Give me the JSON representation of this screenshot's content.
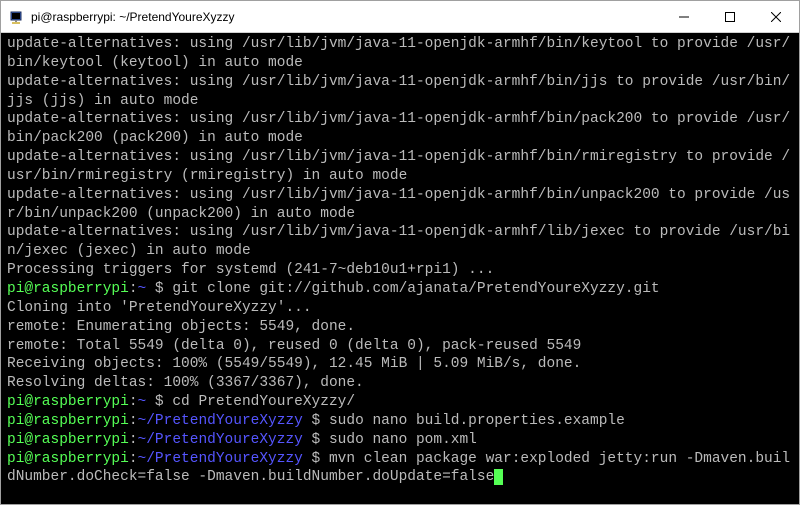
{
  "window": {
    "title": "pi@raspberrypi: ~/PretendYoureXyzzy"
  },
  "terminal": {
    "lines": [
      "update-alternatives: using /usr/lib/jvm/java-11-openjdk-armhf/bin/keytool to provide /usr/bin/keytool (keytool) in auto mode",
      "update-alternatives: using /usr/lib/jvm/java-11-openjdk-armhf/bin/jjs to provide /usr/bin/jjs (jjs) in auto mode",
      "update-alternatives: using /usr/lib/jvm/java-11-openjdk-armhf/bin/pack200 to provide /usr/bin/pack200 (pack200) in auto mode",
      "update-alternatives: using /usr/lib/jvm/java-11-openjdk-armhf/bin/rmiregistry to provide /usr/bin/rmiregistry (rmiregistry) in auto mode",
      "update-alternatives: using /usr/lib/jvm/java-11-openjdk-armhf/bin/unpack200 to provide /usr/bin/unpack200 (unpack200) in auto mode",
      "update-alternatives: using /usr/lib/jvm/java-11-openjdk-armhf/lib/jexec to provide /usr/bin/jexec (jexec) in auto mode",
      "Processing triggers for systemd (241-7~deb10u1+rpi1) ..."
    ],
    "prompts": [
      {
        "user_host": "pi@raspberrypi",
        "colon": ":",
        "path": "~",
        "dollar": " $ ",
        "command": "git clone git://github.com/ajanata/PretendYoureXyzzy.git"
      }
    ],
    "git_output": [
      "Cloning into 'PretendYoureXyzzy'...",
      "remote: Enumerating objects: 5549, done.",
      "remote: Total 5549 (delta 0), reused 0 (delta 0), pack-reused 5549",
      "Receiving objects: 100% (5549/5549), 12.45 MiB | 5.09 MiB/s, done.",
      "Resolving deltas: 100% (3367/3367), done."
    ],
    "prompts2": [
      {
        "user_host": "pi@raspberrypi",
        "colon": ":",
        "path": "~",
        "dollar": " $ ",
        "command": "cd PretendYoureXyzzy/"
      },
      {
        "user_host": "pi@raspberrypi",
        "colon": ":",
        "path": "~/PretendYoureXyzzy",
        "dollar": " $ ",
        "command": "sudo nano build.properties.example"
      },
      {
        "user_host": "pi@raspberrypi",
        "colon": ":",
        "path": "~/PretendYoureXyzzy",
        "dollar": " $ ",
        "command": "sudo nano pom.xml"
      },
      {
        "user_host": "pi@raspberrypi",
        "colon": ":",
        "path": "~/PretendYoureXyzzy",
        "dollar": " $ ",
        "command": "mvn clean package war:exploded jetty:run -Dmaven.buildNumber.doCheck=false -Dmaven.buildNumber.doUpdate=false"
      }
    ]
  }
}
